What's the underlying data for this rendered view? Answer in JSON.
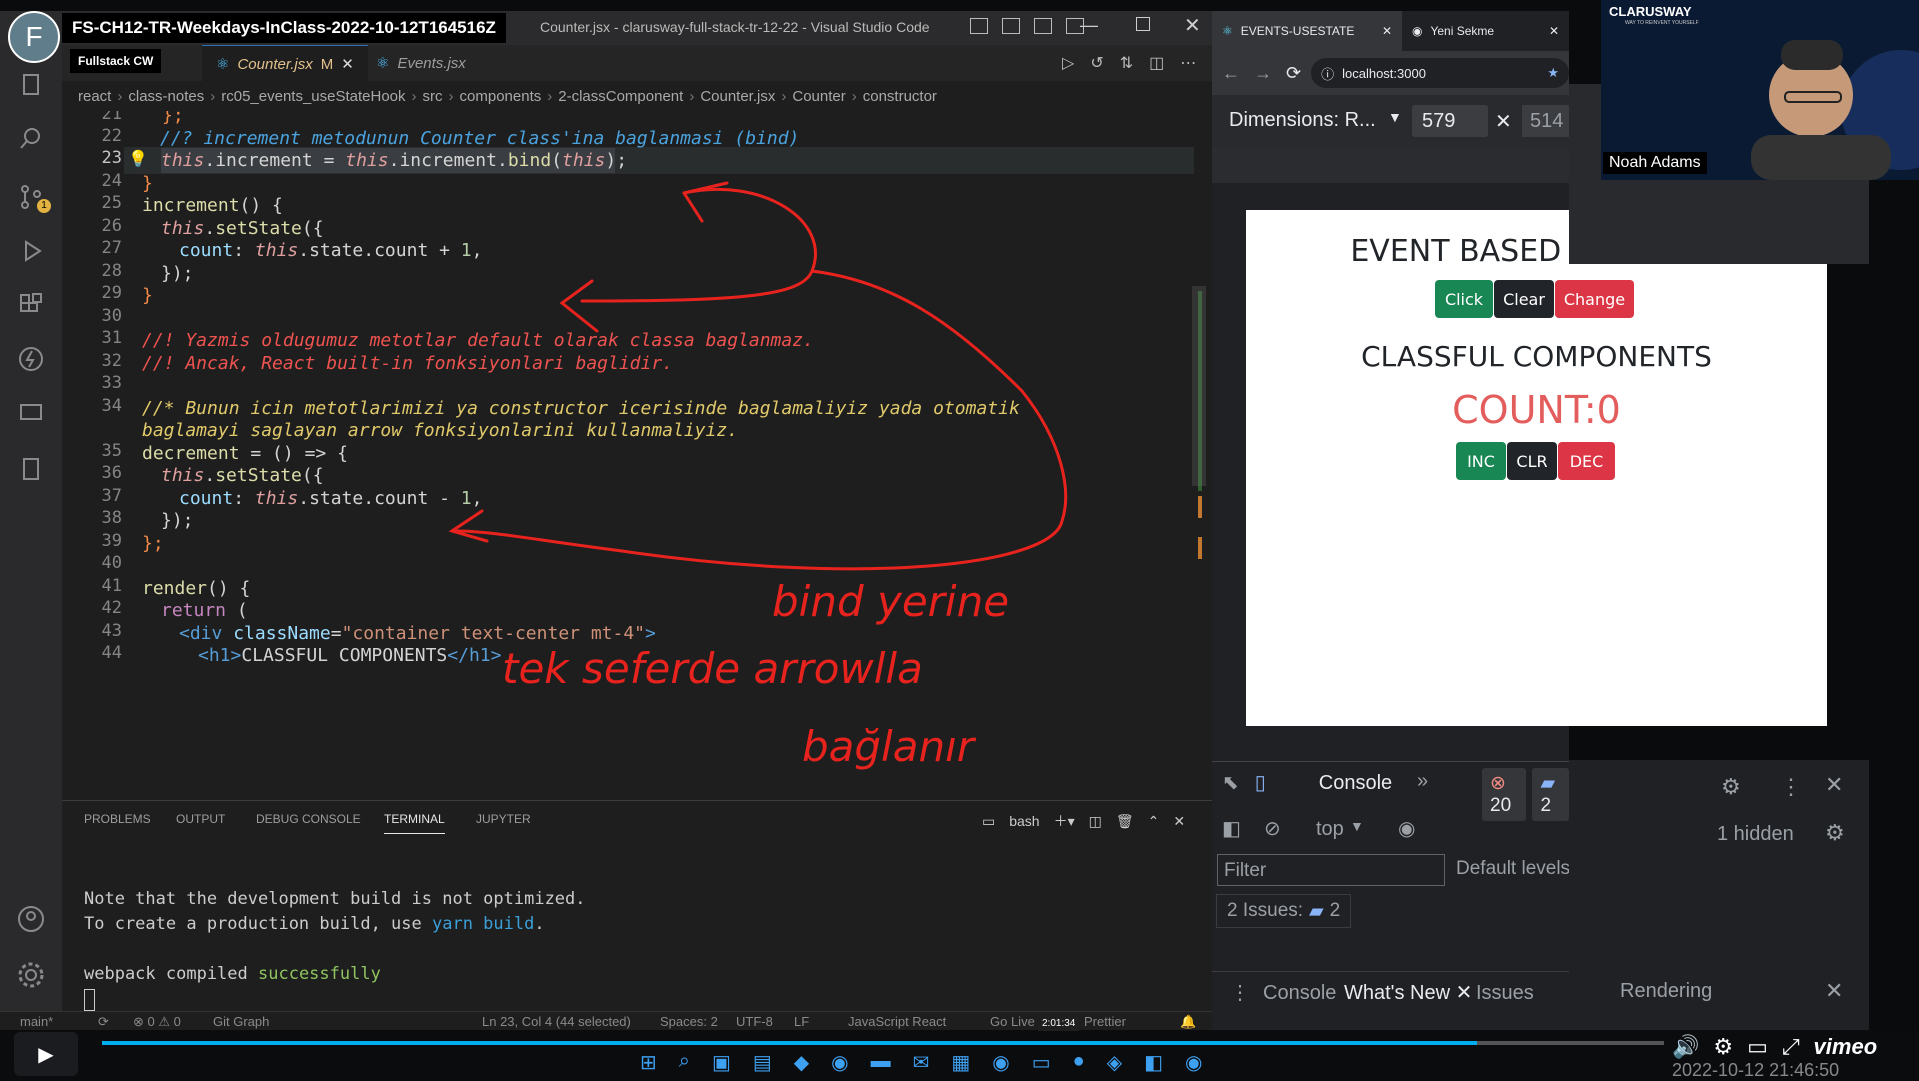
{
  "vscode": {
    "title": "FS-CH12-TR-Weekdays-InClass-2022-10-12T164516Z",
    "window_title": "Counter.jsx - clarusway-full-stack-tr-12-22 - Visual Studio Code",
    "avatar_letter": "F",
    "tooltip": "Fullstack CW",
    "tabs": [
      {
        "label": "Counter.jsx",
        "modified": "M"
      },
      {
        "label": "Events.jsx"
      }
    ],
    "breadcrumb": [
      "react",
      "class-notes",
      "rc05_events_useStateHook",
      "src",
      "components",
      "2-classComponent",
      "Counter.jsx",
      "Counter",
      "constructor"
    ],
    "line_numbers": [
      "21",
      "22",
      "23",
      "24",
      "25",
      "26",
      "27",
      "28",
      "29",
      "30",
      "31",
      "32",
      "33",
      "34",
      "",
      "35",
      "36",
      "37",
      "38",
      "39",
      "40",
      "41",
      "42",
      "43",
      "44"
    ],
    "code": {
      "l21": "};",
      "l22": "//? increment metodunun Counter class'ina baglanmasi (bind)",
      "l23_a": "this",
      "l23_b": ".increment = ",
      "l23_c": "this",
      "l23_d": ".increment.",
      "l23_e": "bind",
      "l23_f": "(",
      "l23_g": "this",
      "l23_h": ");",
      "l24": "}",
      "l25_a": "increment",
      "l25_b": "() {",
      "l26_a": "this",
      "l26_b": ".",
      "l26_c": "setState",
      "l26_d": "({",
      "l27_a": "count",
      "l27_b": ": ",
      "l27_c": "this",
      "l27_d": ".state.count + ",
      "l27_e": "1",
      "l27_f": ",",
      "l28": "});",
      "l29": "}",
      "l31": "//! Yazmis oldugumuz metotlar default olarak classa baglanmaz.",
      "l32": "//! Ancak, React built-in fonksiyonlari baglidir.",
      "l34": "//* Bunun icin metotlarimizi ya constructor icerisinde baglamaliyiz yada otomatik",
      "l34b": "baglamayi saglayan arrow fonksiyonlarini kullanmaliyiz.",
      "l35_a": "decrement",
      "l35_b": " = () => {",
      "l36_a": "this",
      "l36_b": ".",
      "l36_c": "setState",
      "l36_d": "({",
      "l37_a": "count",
      "l37_b": ": ",
      "l37_c": "this",
      "l37_d": ".state.count - ",
      "l37_e": "1",
      "l37_f": ",",
      "l38": "});",
      "l39": "};",
      "l41_a": "render",
      "l41_b": "() {",
      "l42_a": "return",
      "l42_b": " (",
      "l43_a": "<div ",
      "l43_b": "className",
      "l43_c": "=",
      "l43_d": "\"container text-center mt-4\"",
      "l43_e": ">",
      "l44_a": "<h1>",
      "l44_b": "CLASSFUL COMPONENTS",
      "l44_c": "</h1>"
    },
    "handwriting": {
      "line1": "bind yerine",
      "line2": "tek seferde arrowlla",
      "line3": "bağlanır"
    },
    "panel": {
      "tabs": [
        "PROBLEMS",
        "OUTPUT",
        "DEBUG CONSOLE",
        "TERMINAL",
        "JUPYTER"
      ],
      "shell": "bash",
      "terminal_lines": {
        "t1": "Note that the development build is not optimized.",
        "t2a": "To create a production build, use ",
        "t2b": "yarn build",
        "t2c": ".",
        "t3a": "webpack compiled ",
        "t3b": "successfully"
      }
    },
    "status": {
      "branch": "main*",
      "problems": "⊗ 0 ⚠ 0",
      "git_graph": "Git Graph",
      "position": "Ln 23, Col 4 (44 selected)",
      "spaces": "Spaces: 2",
      "encoding": "UTF-8",
      "eol": "LF",
      "language": "JavaScript React",
      "golive": "Go Live",
      "prettier": "Prettier"
    }
  },
  "browser": {
    "tabs": [
      {
        "label": "EVENTS-USESTATE"
      },
      {
        "label": "Yeni Sekme"
      }
    ],
    "url": "localhost:3000",
    "dimensions": {
      "label": "Dimensions: R...",
      "width": "579",
      "height": "514"
    },
    "page": {
      "heading1": "EVENT BASED PROGRAM",
      "buttons1": [
        "Click",
        "Clear",
        "Change"
      ],
      "heading2": "CLASSFUL COMPONENTS",
      "count": "COUNT:0",
      "buttons2": [
        "INC",
        "CLR",
        "DEC"
      ]
    },
    "devtools": {
      "tab": "Console",
      "errors": "20",
      "messages": "2",
      "context": "top",
      "hidden": "1 hidden",
      "filter_placeholder": "Filter",
      "levels": "Default levels",
      "issues_label": "2 Issues:",
      "issues_count": "2",
      "drawer_tabs": [
        "Console",
        "What's New",
        "Issues",
        "Rendering"
      ]
    }
  },
  "webcam": {
    "name": "Noah Adams",
    "logo": "CLARUSWAY",
    "logo_sub": "WAY TO REINVENT YOURSELF"
  },
  "player": {
    "time": "2:01:34",
    "timestamp": "2022-10-12 21:46:50",
    "brand": "vimeo",
    "progress": 0.88
  },
  "colors": {
    "green": "#198754",
    "dark": "#212529",
    "red": "#dc3545",
    "count_red": "#e35d5d",
    "annotation": "#e8231e"
  }
}
